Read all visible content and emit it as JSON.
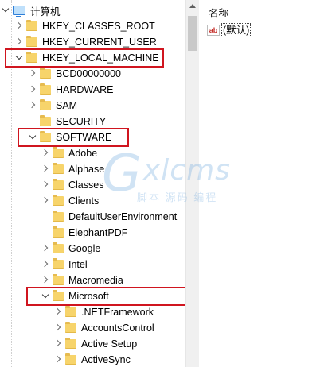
{
  "tree": {
    "rows": [
      {
        "label": "计算机",
        "icon": "computer-icon",
        "state": "expanded"
      },
      {
        "label": "HKEY_CLASSES_ROOT",
        "icon": "folder-icon",
        "state": "collapsed"
      },
      {
        "label": "HKEY_CURRENT_USER",
        "icon": "folder-icon",
        "state": "collapsed"
      },
      {
        "label": "HKEY_LOCAL_MACHINE",
        "icon": "folder-icon",
        "state": "expanded"
      },
      {
        "label": "BCD00000000",
        "icon": "folder-icon",
        "state": "collapsed"
      },
      {
        "label": "HARDWARE",
        "icon": "folder-icon",
        "state": "collapsed"
      },
      {
        "label": "SAM",
        "icon": "folder-icon",
        "state": "collapsed"
      },
      {
        "label": "SECURITY",
        "icon": "folder-icon",
        "state": "leaf"
      },
      {
        "label": "SOFTWARE",
        "icon": "folder-icon",
        "state": "expanded"
      },
      {
        "label": "Adobe",
        "icon": "folder-icon",
        "state": "collapsed"
      },
      {
        "label": "Alphase",
        "icon": "folder-icon",
        "state": "collapsed"
      },
      {
        "label": "Classes",
        "icon": "folder-icon",
        "state": "collapsed"
      },
      {
        "label": "Clients",
        "icon": "folder-icon",
        "state": "collapsed"
      },
      {
        "label": "DefaultUserEnvironment",
        "icon": "folder-icon",
        "state": "leaf"
      },
      {
        "label": "ElephantPDF",
        "icon": "folder-icon",
        "state": "leaf"
      },
      {
        "label": "Google",
        "icon": "folder-icon",
        "state": "collapsed"
      },
      {
        "label": "Intel",
        "icon": "folder-icon",
        "state": "collapsed"
      },
      {
        "label": "Macromedia",
        "icon": "folder-icon",
        "state": "collapsed"
      },
      {
        "label": "Microsoft",
        "icon": "folder-icon",
        "state": "expanded"
      },
      {
        "label": ".NETFramework",
        "icon": "folder-icon",
        "state": "collapsed"
      },
      {
        "label": "AccountsControl",
        "icon": "folder-icon",
        "state": "collapsed"
      },
      {
        "label": "Active Setup",
        "icon": "folder-icon",
        "state": "collapsed"
      },
      {
        "label": "ActiveSync",
        "icon": "folder-icon",
        "state": "collapsed"
      }
    ]
  },
  "list": {
    "column_name": "名称",
    "values": [
      {
        "icon": "ab-icon",
        "icon_text": "ab",
        "name": "(默认)"
      }
    ]
  },
  "watermark": {
    "logo_letter": "G",
    "logo_text": "xlcms",
    "subtitle": "脚本 源码 编程"
  },
  "colors": {
    "highlight": "#d0151f",
    "folder": "#f7d46b",
    "computer_icon": "#2f7fd8"
  }
}
